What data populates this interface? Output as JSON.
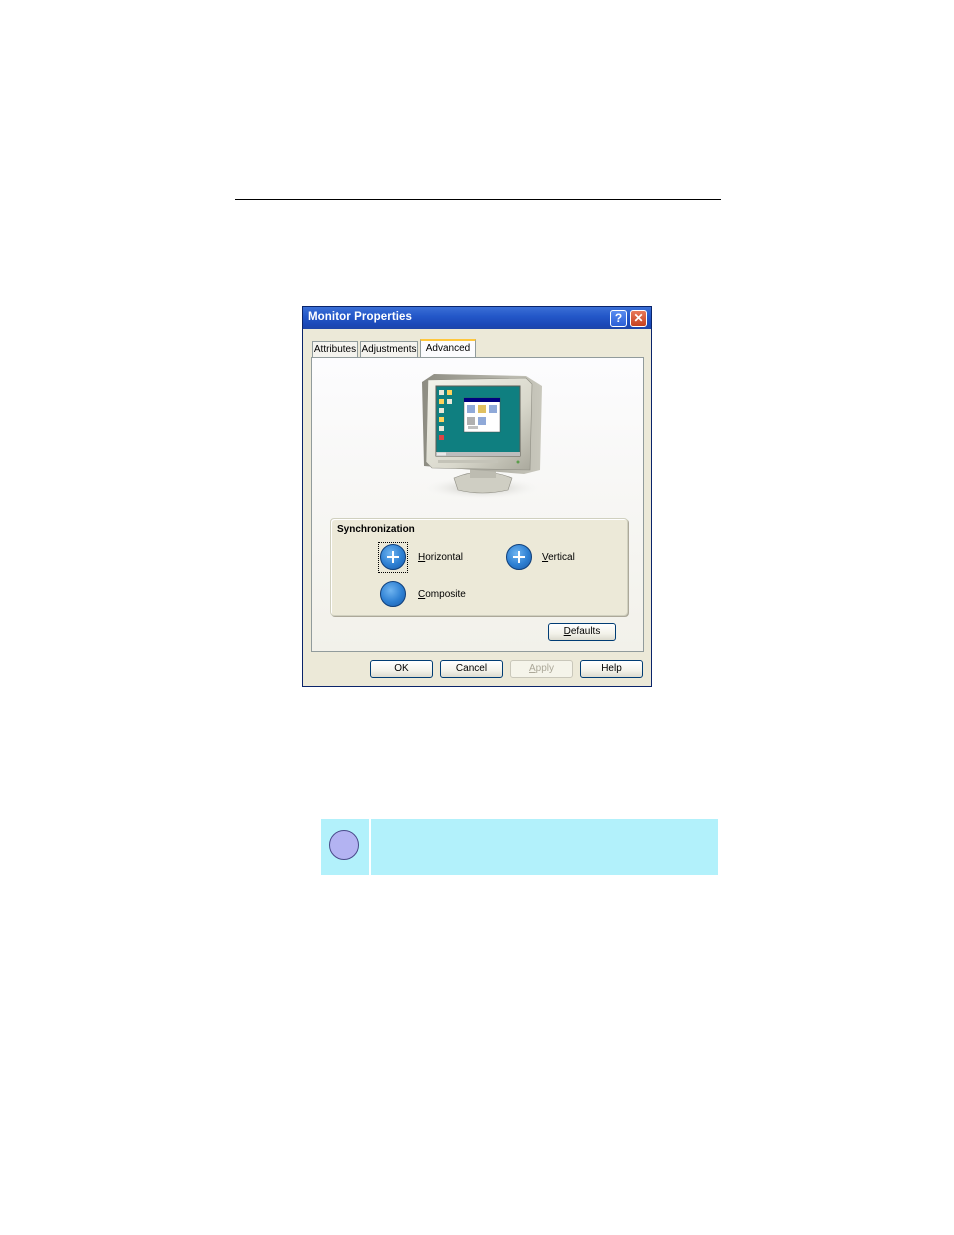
{
  "dialog": {
    "title": "Monitor Properties",
    "help_button": "?",
    "close_button": "✕",
    "tabs": [
      {
        "label": "Attributes",
        "active": false
      },
      {
        "label": "Adjustments",
        "active": false
      },
      {
        "label": "Advanced",
        "active": true
      }
    ],
    "sync_group": {
      "label": "Synchronization",
      "options": {
        "horizontal": {
          "label_pre": "",
          "mnemonic": "H",
          "label_post": "orizontal"
        },
        "vertical": {
          "label_pre": "",
          "mnemonic": "V",
          "label_post": "ertical"
        },
        "composite": {
          "label_pre": "",
          "mnemonic": "C",
          "label_post": "omposite"
        }
      }
    },
    "defaults_button": {
      "mnemonic": "D",
      "rest": "efaults"
    },
    "buttons": {
      "ok": "OK",
      "cancel": "Cancel",
      "apply": {
        "mnemonic": "A",
        "rest": "pply"
      },
      "help": "Help"
    }
  },
  "colors": {
    "note_background": "#b2f1fb",
    "title_bar": "#2458c9",
    "dialog_background": "#ece9d8"
  }
}
